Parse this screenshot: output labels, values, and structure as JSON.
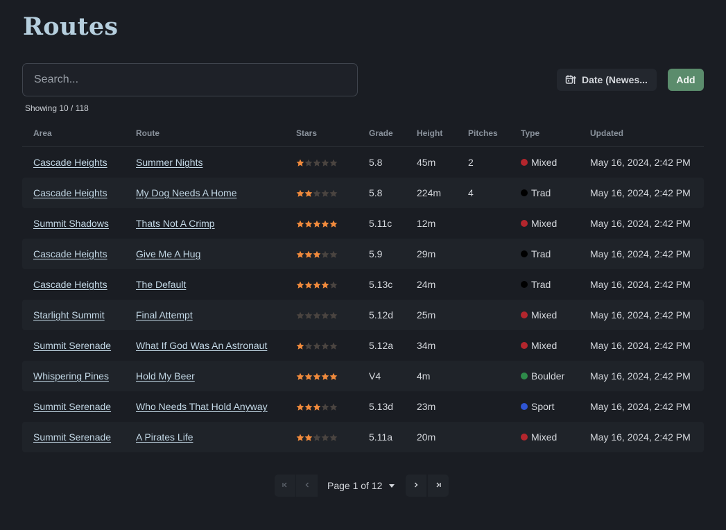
{
  "header": {
    "title": "Routes"
  },
  "toolbar": {
    "search_placeholder": "Search...",
    "sort_label": "Date (Newes...",
    "add_label": "Add"
  },
  "summary": {
    "showing": "Showing 10 / 118"
  },
  "table": {
    "columns": [
      "Area",
      "Route",
      "Stars",
      "Grade",
      "Height",
      "Pitches",
      "Type",
      "Updated"
    ],
    "rows": [
      {
        "area": "Cascade Heights",
        "route": "Summer Nights",
        "stars": 1,
        "grade": "5.8",
        "height": "45m",
        "pitches": "2",
        "type": "Mixed",
        "updated": "May 16, 2024, 2:42 PM"
      },
      {
        "area": "Cascade Heights",
        "route": "My Dog Needs A Home",
        "stars": 2,
        "grade": "5.8",
        "height": "224m",
        "pitches": "4",
        "type": "Trad",
        "updated": "May 16, 2024, 2:42 PM"
      },
      {
        "area": "Summit Shadows",
        "route": "Thats Not A Crimp",
        "stars": 5,
        "grade": "5.11c",
        "height": "12m",
        "pitches": "",
        "type": "Mixed",
        "updated": "May 16, 2024, 2:42 PM"
      },
      {
        "area": "Cascade Heights",
        "route": "Give Me A Hug",
        "stars": 3,
        "grade": "5.9",
        "height": "29m",
        "pitches": "",
        "type": "Trad",
        "updated": "May 16, 2024, 2:42 PM"
      },
      {
        "area": "Cascade Heights",
        "route": "The Default",
        "stars": 4,
        "grade": "5.13c",
        "height": "24m",
        "pitches": "",
        "type": "Trad",
        "updated": "May 16, 2024, 2:42 PM"
      },
      {
        "area": "Starlight Summit",
        "route": "Final Attempt",
        "stars": 0,
        "grade": "5.12d",
        "height": "25m",
        "pitches": "",
        "type": "Mixed",
        "updated": "May 16, 2024, 2:42 PM"
      },
      {
        "area": "Summit Serenade",
        "route": "What If God Was An Astronaut",
        "stars": 1,
        "grade": "5.12a",
        "height": "34m",
        "pitches": "",
        "type": "Mixed",
        "updated": "May 16, 2024, 2:42 PM"
      },
      {
        "area": "Whispering Pines",
        "route": "Hold My Beer",
        "stars": 5,
        "grade": "V4",
        "height": "4m",
        "pitches": "",
        "type": "Boulder",
        "updated": "May 16, 2024, 2:42 PM"
      },
      {
        "area": "Summit Serenade",
        "route": "Who Needs That Hold Anyway",
        "stars": 3,
        "grade": "5.13d",
        "height": "23m",
        "pitches": "",
        "type": "Sport",
        "updated": "May 16, 2024, 2:42 PM"
      },
      {
        "area": "Summit Serenade",
        "route": "A Pirates Life",
        "stars": 2,
        "grade": "5.11a",
        "height": "20m",
        "pitches": "",
        "type": "Mixed",
        "updated": "May 16, 2024, 2:42 PM"
      }
    ],
    "max_stars": 5
  },
  "type_colors": {
    "Mixed": "#b3262d",
    "Trad": "#000000",
    "Boulder": "#2e8b4a",
    "Sport": "#2f55d4"
  },
  "colors": {
    "star_filled": "#f08a3c",
    "star_empty": "#4a4440",
    "accent_add": "#5b8c6c",
    "title": "#b6cfde"
  },
  "pagination": {
    "label": "Page 1 of 12",
    "icons": {
      "first": "first-page-icon",
      "prev": "prev-page-icon",
      "next": "next-page-icon",
      "last": "last-page-icon"
    }
  },
  "icons": {
    "sort": "calendar-sort-icon",
    "dropdown": "caret-down-icon"
  }
}
